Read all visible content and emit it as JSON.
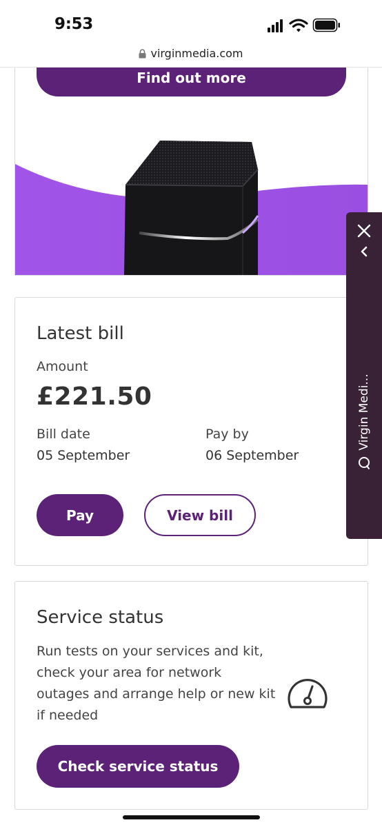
{
  "status_bar": {
    "time": "9:53"
  },
  "browser": {
    "url": "virginmedia.com"
  },
  "promo": {
    "button_label": "Find out more"
  },
  "bill": {
    "title": "Latest bill",
    "amount_label": "Amount",
    "amount": "£221.50",
    "bill_date_label": "Bill date",
    "bill_date": "05 September",
    "pay_by_label": "Pay by",
    "pay_by": "06 September",
    "pay_button": "Pay",
    "view_button": "View bill"
  },
  "service": {
    "title": "Service status",
    "description": "Run tests on your services and kit, check your area for network outages and arrange help or new kit if needed",
    "button": "Check service status",
    "icon": "speedometer-icon"
  },
  "chat": {
    "label": "Virgin Medi..."
  },
  "colors": {
    "brand_purple": "#5c2277",
    "chat_bg": "#3a2236",
    "accent_purple": "#a155e8"
  }
}
